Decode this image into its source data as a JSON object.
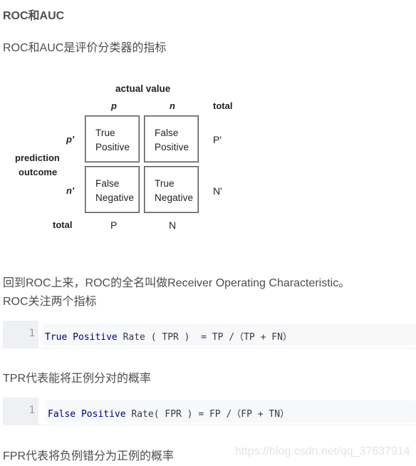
{
  "article": {
    "heading": "ROC和AUC",
    "intro": "ROC和AUC是评价分类器的指标",
    "para_roc_name": "回到ROC上来，ROC的全名叫做Receiver Operating Characteristic。",
    "para_roc_focus": "ROC关注两个指标",
    "para_tpr_desc": "TPR代表能将正例分对的概率",
    "para_fpr_desc": "FPR代表将负例错分为正例的概率"
  },
  "confusion_matrix": {
    "actual_label": "actual value",
    "prediction_label_line1": "prediction",
    "prediction_label_line2": "outcome",
    "col_headers": [
      "p",
      "n"
    ],
    "row_headers": [
      "p'",
      "n'"
    ],
    "total_label": "total",
    "row_totals": [
      "P'",
      "N'"
    ],
    "col_totals": [
      "P",
      "N"
    ],
    "cells": [
      {
        "line1": "True",
        "line2": "Positive"
      },
      {
        "line1": "False",
        "line2": "Positive"
      },
      {
        "line1": "False",
        "line2": "Negative"
      },
      {
        "line1": "True",
        "line2": "Negative"
      }
    ]
  },
  "code_blocks": [
    {
      "line_number": "1",
      "keyword": "True Positive",
      "rest": " Rate ( TPR )  = TP /（TP + FN）"
    },
    {
      "line_number": "1",
      "keyword": "False Positive",
      "rest": " Rate( FPR ) = FP /（FP + TN）"
    }
  ],
  "watermark": "https://blog.csdn.net/qq_37637914"
}
